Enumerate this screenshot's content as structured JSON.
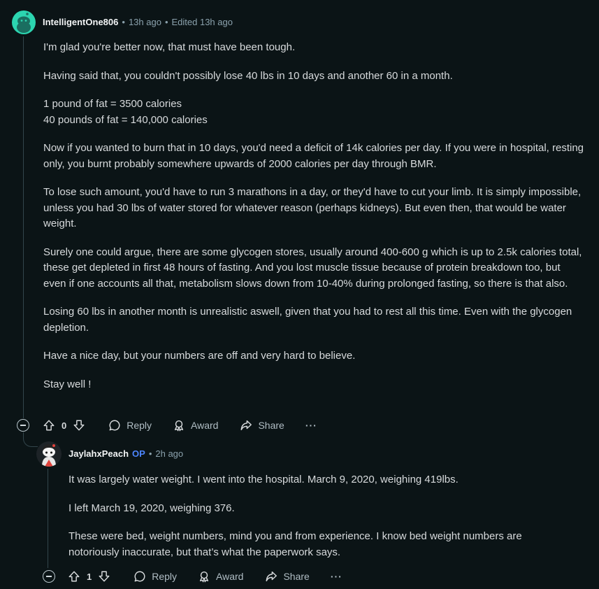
{
  "comment1": {
    "username": "IntelligentOne806",
    "separator": "•",
    "time": "13h ago",
    "edited": "Edited 13h ago",
    "paragraphs": [
      [
        "I'm glad you're better now, that must have been tough."
      ],
      [
        "Having said that, you couldn't possibly lose 40 lbs in 10 days and another 60 in a month."
      ],
      [
        "1 pound of fat = 3500 calories",
        "40 pounds of fat = 140,000 calories"
      ],
      [
        "Now if you wanted to burn that in 10 days, you'd need a deficit of 14k calories per day. If you were in hospital, resting only, you burnt probably somewhere upwards of 2000 calories per day through BMR."
      ],
      [
        "To lose such amount, you'd have to run 3 marathons in a day, or they'd have to cut your limb. It is simply impossible, unless you had 30 lbs of water stored for whatever reason (perhaps kidneys). But even then, that would be water weight."
      ],
      [
        "Surely one could argue, there are some glycogen stores, usually around 400-600 g which is up to 2.5k calories total, these get depleted in first 48 hours of fasting. And you lost muscle tissue because of protein breakdown too, but even if one accounts all that, metabolism slows down from 10-40% during prolonged fasting, so there is that also."
      ],
      [
        "Losing 60 lbs in another month is unrealistic aswell, given that you had to rest all this time. Even with the glycogen depletion."
      ],
      [
        "Have a nice day, but your numbers are off and very hard to believe."
      ],
      [
        "Stay well !"
      ]
    ],
    "score": "0",
    "reply_label": "Reply",
    "award_label": "Award",
    "share_label": "Share",
    "more_label": "···"
  },
  "comment2": {
    "username": "JaylahxPeach",
    "op_badge": "OP",
    "separator": "•",
    "time": "2h ago",
    "paragraphs": [
      [
        "It was largely water weight. I went into the hospital. March 9, 2020, weighing 419lbs."
      ],
      [
        "I left March 19, 2020, weighing 376."
      ],
      [
        "These were bed, weight numbers, mind you and from experience. I know bed weight numbers are notoriously inaccurate, but that’s what the paperwork says."
      ]
    ],
    "score": "1",
    "reply_label": "Reply",
    "award_label": "Award",
    "share_label": "Share",
    "more_label": "···"
  },
  "colors": {
    "background": "#0b1416",
    "avatar1": "#2cd5b0",
    "op": "#4d86ff"
  },
  "icons": [
    "snoo-avatar-icon",
    "upvote-icon",
    "downvote-icon",
    "comment-icon",
    "award-icon",
    "share-icon",
    "collapse-icon",
    "more-icon"
  ]
}
